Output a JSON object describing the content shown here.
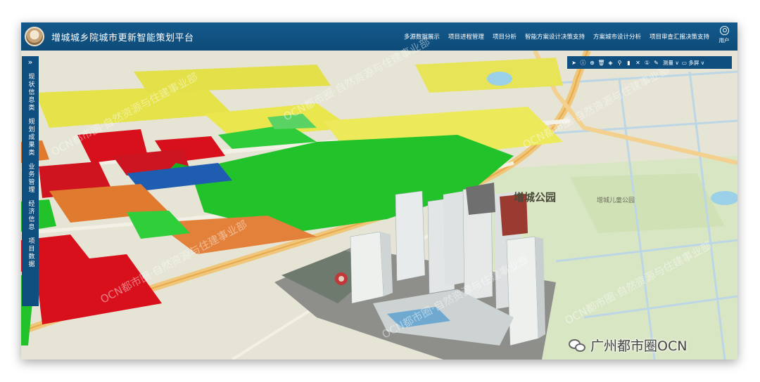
{
  "header": {
    "title": "增城城乡院城市更新智能策划平台",
    "nav": [
      "多源数据展示",
      "项目进程管理",
      "项目分析",
      "智能方案设计决策支持",
      "方案城市设计分析",
      "项目审查汇报决策支持"
    ],
    "user_label": "用户"
  },
  "sidebar": {
    "toggle": "»",
    "items": [
      "现状信息类",
      "规划成果类",
      "业务管理",
      "经济信息",
      "项目数据"
    ]
  },
  "toolbar": {
    "icons": [
      "cursor-icon",
      "info-icon",
      "globe-icon",
      "trash-icon",
      "layers-icon",
      "pin-icon",
      "building-icon",
      "close-icon",
      "info-circle-icon",
      "ruler-icon"
    ],
    "glyphs": [
      "➤",
      "ⓘ",
      "⊕",
      "🗑",
      "◈",
      "⚲",
      "▮",
      "✕",
      "①",
      "✎"
    ],
    "measure_label": "测量 ∨",
    "window_label": "▭ 多屏 ∨"
  },
  "map": {
    "park_label": "增城公园",
    "park_label2": "增城儿童公园"
  },
  "watermarks": [
    "OCN都市圈·自然资源与住建事业部",
    "OCN都市圈·自然资源与住建事业部",
    "OCN都市圈·自然资源与住建事业部",
    "OCN都市圈·自然资源与住建事业部",
    "OCN都市圈·自然资源与住建事业部",
    "OCN都市圈·自然资源与住建事业部"
  ],
  "brand": {
    "text": "广州都市圈OCN"
  }
}
